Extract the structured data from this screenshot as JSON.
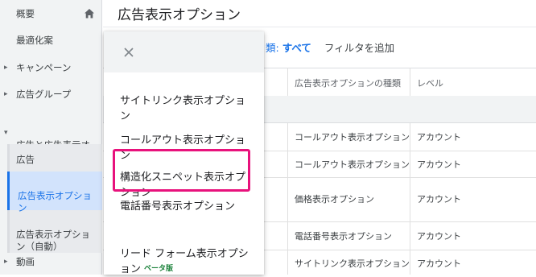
{
  "sidebar": {
    "items": [
      {
        "label": "概要"
      },
      {
        "label": "最適化案"
      },
      {
        "label": "キャンペーン"
      },
      {
        "label": "広告グループ"
      },
      {
        "label": "広告と広告表示オ\nプション"
      },
      {
        "label": "動画"
      }
    ],
    "sub_items": [
      {
        "label": "広告"
      },
      {
        "label": "広告表示オプショ\nン"
      },
      {
        "label": "広告表示オプショ\nン（自動）"
      }
    ]
  },
  "main": {
    "title": "広告表示オプション",
    "filter": {
      "prefix": "類:",
      "all": "すべて",
      "add": "フィルタを追加"
    },
    "columns": [
      "広告表示オプションの種類",
      "レベル"
    ],
    "rows": [
      {
        "type": "コールアウト表示オプション",
        "level": "アカウント"
      },
      {
        "type": "コールアウト表示オプション",
        "level": "アカウント"
      },
      {
        "type": "価格表示オプション",
        "level": "アカウント"
      },
      {
        "type": "電話番号表示オプション",
        "level": "アカウント"
      },
      {
        "type": "サイトリンク表示オプション",
        "level": "アカウント"
      }
    ]
  },
  "menu": {
    "items": [
      {
        "label": "サイトリンク表示オプショ\nン"
      },
      {
        "label": "コールアウト表示オプショ\nン"
      },
      {
        "label": "構造化スニペット表示オプ\nション"
      },
      {
        "label": "電話番号表示オプション"
      },
      {
        "label": "リード フォーム表示オプシ\nョン"
      }
    ],
    "beta_label": "ベータ版"
  },
  "colors": {
    "accent": "#1a73e8",
    "highlight": "#e8127c",
    "beta": "#188038"
  }
}
